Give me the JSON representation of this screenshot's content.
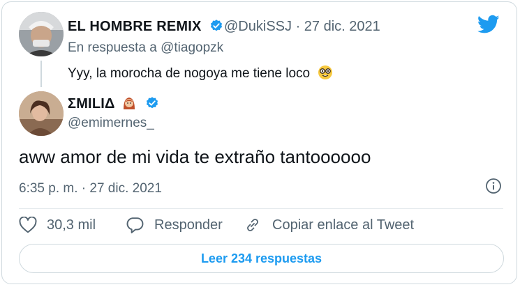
{
  "tweet_reply": {
    "display_name": "EL HOMBRE REMIX",
    "handle": "@DukiSSJ",
    "separator": "·",
    "date": "27 dic. 2021",
    "reply_context": "En respuesta a @tiagopzk",
    "text": "Yyy, la morocha de nogoya me tiene loco"
  },
  "tweet_main": {
    "display_name": "ΣMILIΔ",
    "handle": "@emimernes_",
    "text": "aww amor de mi vida te extraño tantoooooo",
    "timestamp": "6:35 p. m. · 27 dic. 2021"
  },
  "actions": {
    "likes": "30,3 mil",
    "reply_label": "Responder",
    "copy_label": "Copiar enlace al Tweet"
  },
  "read_button": "Leer 234 respuestas",
  "colors": {
    "accent": "#1d9bf0",
    "muted": "#536471",
    "border": "#cfd9de"
  },
  "icons": [
    "twitter-bird-icon",
    "verified-badge-icon",
    "info-icon",
    "heart-icon",
    "reply-bubble-icon",
    "link-icon",
    "nerd-face-emoji-icon",
    "woman-emoji-icon"
  ]
}
